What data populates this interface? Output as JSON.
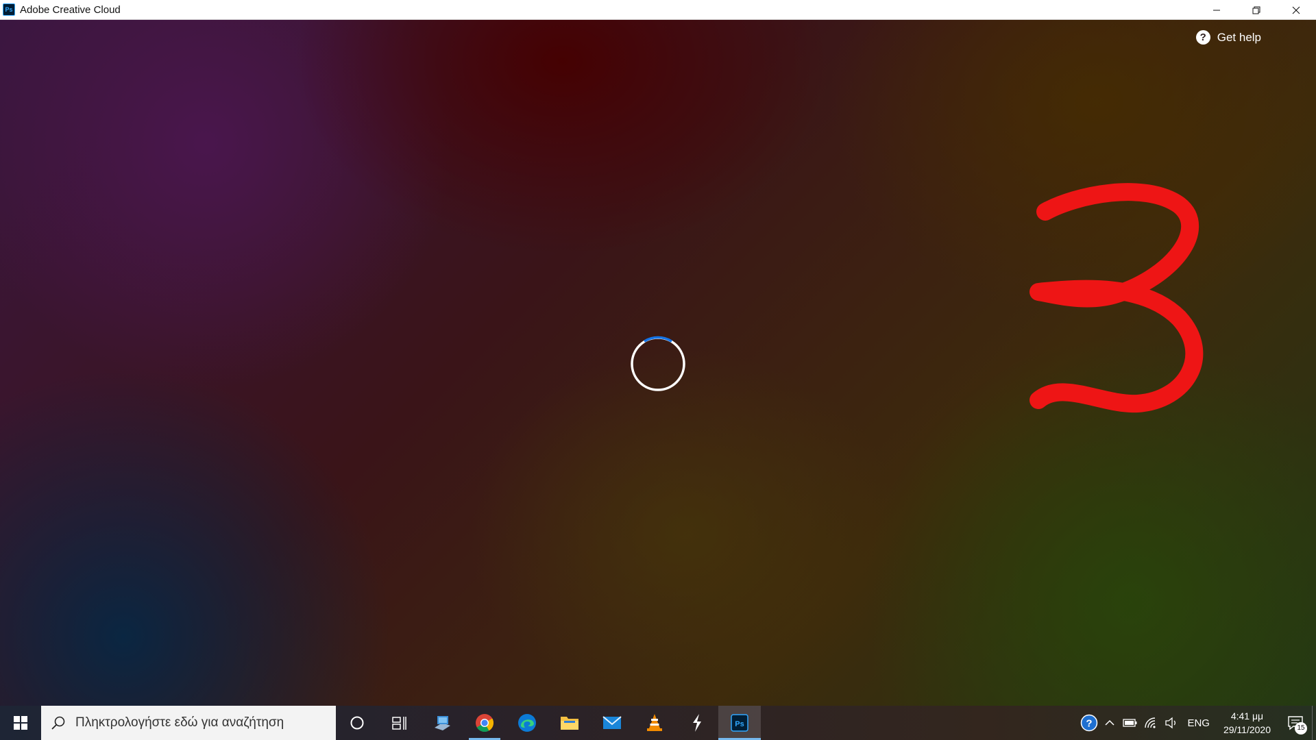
{
  "window": {
    "title": "Adobe Creative Cloud",
    "app_icon_text": "Ps",
    "controls": [
      "minimize",
      "restore",
      "close"
    ]
  },
  "main": {
    "help_label": "Get help",
    "help_icon_glyph": "?",
    "loading_state": "spinner",
    "annotation_glyph": "3",
    "annotation_color": "#ee1515"
  },
  "taskbar": {
    "search_placeholder": "Πληκτρολογήστε εδώ για αναζήτηση",
    "pinned_apps": [
      "cortana",
      "task-view",
      "desktop-app",
      "chrome",
      "edge",
      "file-explorer",
      "mail",
      "vlc",
      "app-s",
      "photoshop"
    ],
    "tray": {
      "language": "ENG",
      "time": "4:41 μμ",
      "date": "29/11/2020",
      "notification_count": "15"
    }
  },
  "colors": {
    "accent": "#76b9ed",
    "photoshop_blue": "#31a8ff",
    "spinner_blue": "#1473e6"
  }
}
